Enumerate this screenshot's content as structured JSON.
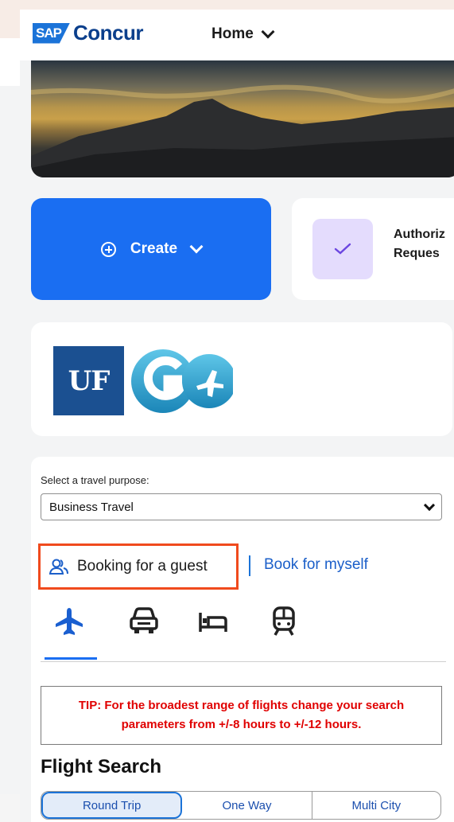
{
  "header": {
    "logo_sap": "SAP",
    "logo_product": "Concur",
    "nav_menu_label": "Home"
  },
  "actions": {
    "create_label": "Create",
    "authorization_line1": "Authoriz",
    "authorization_line2": "Reques"
  },
  "branding": {
    "uf_text": "UF"
  },
  "booking": {
    "purpose_label": "Select a travel purpose:",
    "purpose_value": "Business Travel",
    "guest_label": "Booking for a guest",
    "myself_label": "Book for myself",
    "modes": [
      "flight-icon",
      "car-icon",
      "hotel-icon",
      "rail-icon"
    ],
    "active_mode": "flight-icon",
    "tip_text": "TIP: For the broadest range of flights change your search parameters from +/-8 hours to +/-12 hours.",
    "flight_title": "Flight Search",
    "trip_types": [
      "Round Trip",
      "One Way",
      "Multi City"
    ],
    "active_trip_type": "Round Trip"
  },
  "colors": {
    "primary": "#1a6ef2",
    "tip_red": "#e00000",
    "highlight": "#f04a1d",
    "uf_blue": "#1b5091"
  }
}
